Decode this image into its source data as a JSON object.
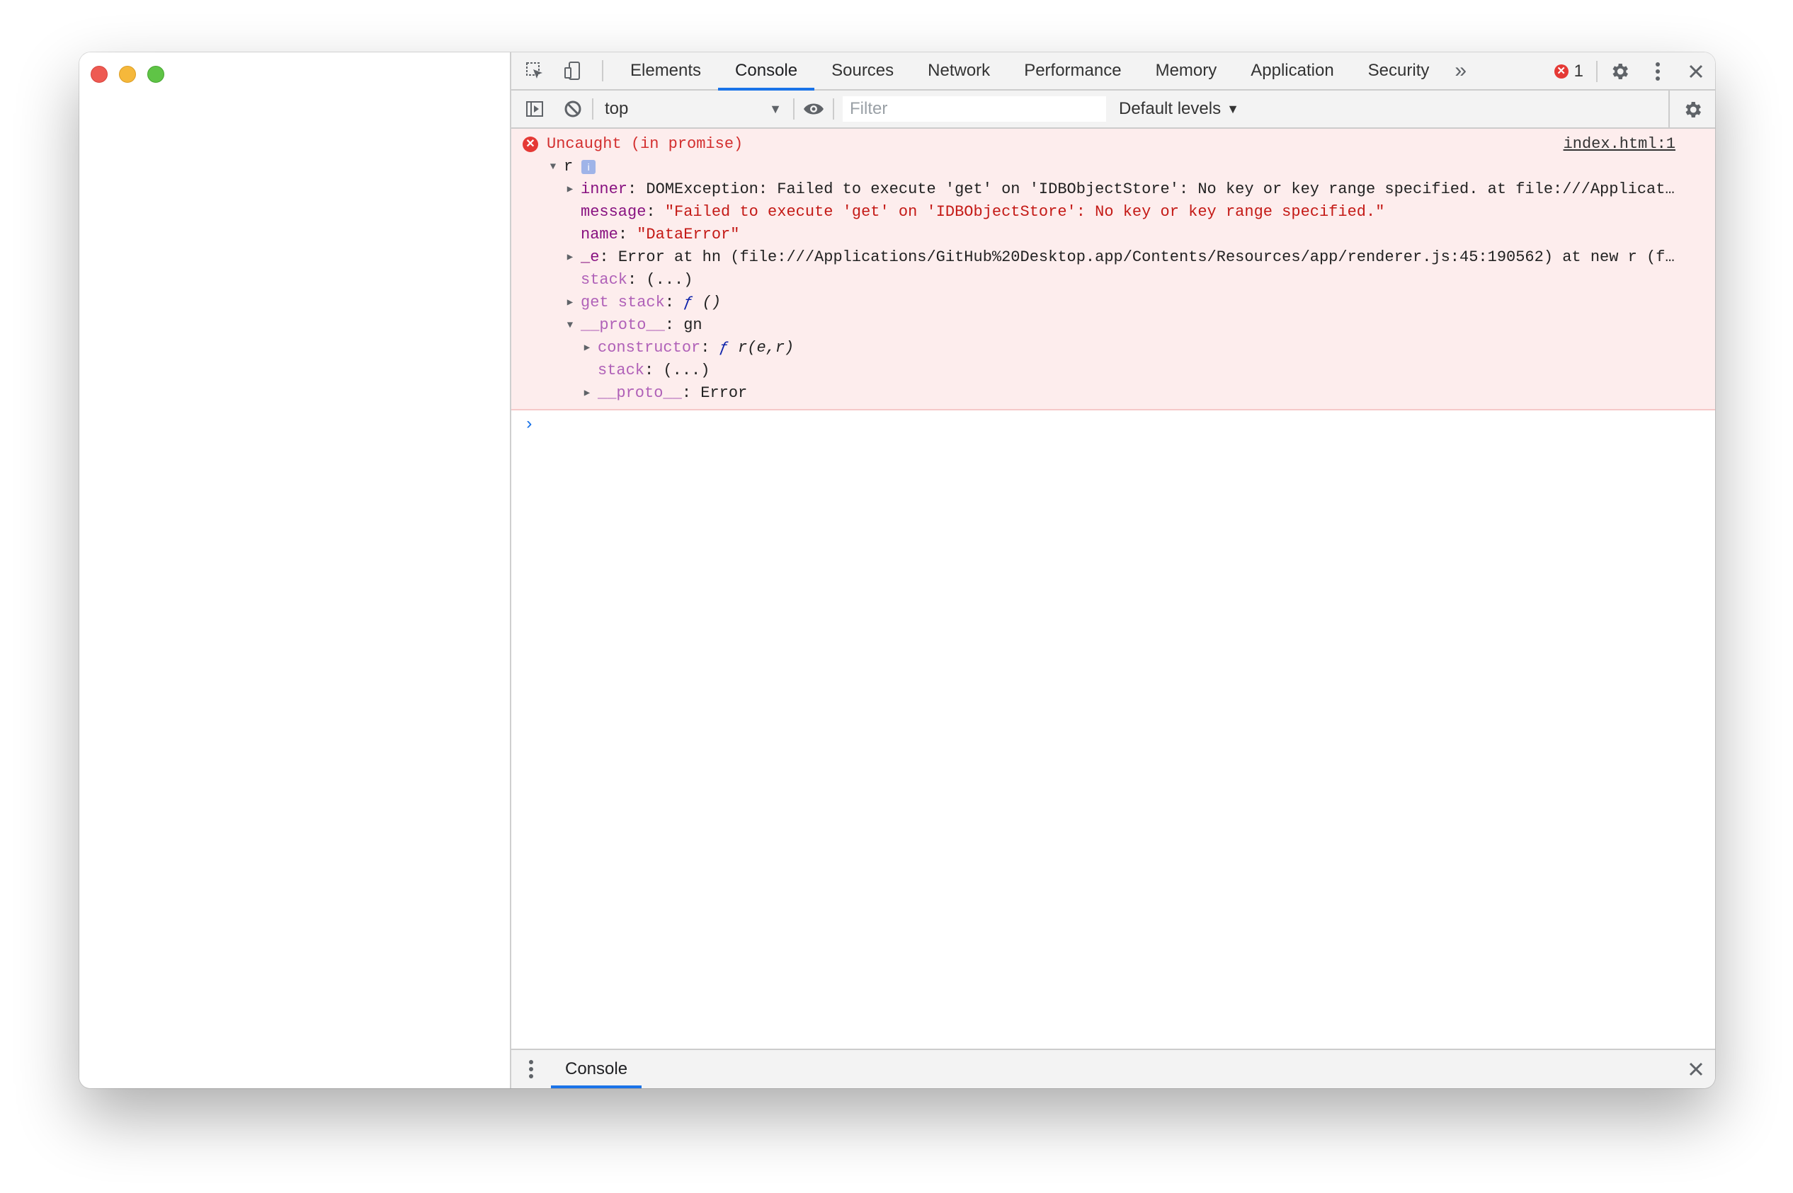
{
  "devtools": {
    "tabs": [
      "Elements",
      "Console",
      "Sources",
      "Network",
      "Performance",
      "Memory",
      "Application",
      "Security"
    ],
    "active_tab": "Console",
    "more_tabs": "»",
    "error_count": "1"
  },
  "console_toolbar": {
    "context": "top",
    "filter_placeholder": "Filter",
    "levels": "Default levels"
  },
  "message": {
    "head": "Uncaught (in promise)",
    "source": "index.html:1",
    "object_name": "r",
    "info_badge": "i",
    "rows": {
      "inner_key": "inner",
      "inner_val": "DOMException: Failed to execute 'get' on 'IDBObjectStore': No key or key range specified. at file:///Applicat…",
      "message_key": "message",
      "message_val": "\"Failed to execute 'get' on 'IDBObjectStore': No key or key range specified.\"",
      "name_key": "name",
      "name_val": "\"DataError\"",
      "e_key": "_e",
      "e_val": "Error at hn (file:///Applications/GitHub%20Desktop.app/Contents/Resources/app/renderer.js:45:190562) at new r (f…",
      "stack_key": "stack",
      "stack_val": "(...)",
      "getstack_key": "get stack",
      "getstack_f": "ƒ",
      "getstack_sig": "()",
      "proto_key": "__proto__",
      "proto_val": "gn",
      "ctor_key": "constructor",
      "ctor_f": "ƒ",
      "ctor_sig": "r(e,r)",
      "stack2_key": "stack",
      "stack2_val": "(...)",
      "proto2_key": "__proto__",
      "proto2_val": "Error"
    }
  },
  "prompt_symbol": "›",
  "drawer": {
    "tab": "Console"
  }
}
